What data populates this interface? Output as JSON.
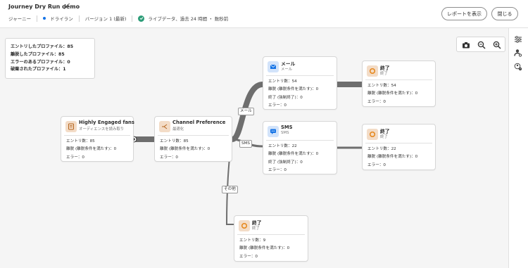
{
  "header": {
    "title": "Journey Dry Run demo",
    "journey_label": "ジャーニー",
    "mode_label": "ドライラン",
    "version_label": "バージョン 1 (最新)",
    "live_label": "ライブデータ、過去 24 時間 ・ 数秒前",
    "report_button": "レポートを表示",
    "close_button": "閉じる"
  },
  "stats": {
    "entered": "エントリしたプロファイル：85",
    "exited": "離脱したプロファイル：85",
    "errors": "エラーのあるプロファイル：0",
    "discarded": "破棄されたプロファイル：1"
  },
  "nodes": {
    "audience": {
      "title": "Highly Engaged fans",
      "subtitle": "オーディエンスを読み取り",
      "entries": "エントリ数：85",
      "exits": "離脱 (離脱条件を満たす)：0",
      "errors": "エラー：0"
    },
    "channel": {
      "title": "Channel Preference",
      "subtitle": "最適化",
      "entries": "エントリ数：85",
      "exits": "離脱 (離脱条件を満たす)：0",
      "errors": "エラー：0"
    },
    "email": {
      "title": "メール",
      "subtitle": "メール",
      "entries": "エントリ数：54",
      "exits": "離脱 (離脱条件を満たす)：0",
      "forced": "終了 (強制終了)：0",
      "errors": "エラー：0"
    },
    "sms": {
      "title": "SMS",
      "subtitle": "SMS",
      "entries": "エントリ数：22",
      "exits": "離脱 (離脱条件を満たす)：0",
      "forced": "終了 (強制終了)：0",
      "errors": "エラー：0"
    },
    "end1": {
      "title": "終了",
      "subtitle": "終了",
      "entries": "エントリ数：54",
      "exits": "離脱 (離脱条件を満たす)：0",
      "errors": "エラー：0"
    },
    "end2": {
      "title": "終了",
      "subtitle": "終了",
      "entries": "エントリ数：22",
      "exits": "離脱 (離脱条件を満たす)：0",
      "errors": "エラー：0"
    },
    "end3": {
      "title": "終了",
      "subtitle": "終了",
      "entries": "エントリ数：9",
      "exits": "離脱 (離脱条件を満たす)：0",
      "errors": "エラー：0"
    }
  },
  "branches": {
    "mail": "メール",
    "sms": "SMS",
    "other": "その他"
  },
  "colors": {
    "accent": "#1473e6",
    "success": "#2d9d78",
    "end_orange": "#e68619",
    "connector": "#6e6e6e"
  },
  "icons": [
    "pencil-icon",
    "camera-icon",
    "zoom-out-icon",
    "zoom-in-icon",
    "settings-sliders-icon",
    "user-settings-icon",
    "user-alert-icon",
    "audience-icon",
    "branch-icon",
    "email-icon",
    "sms-icon",
    "end-icon"
  ]
}
